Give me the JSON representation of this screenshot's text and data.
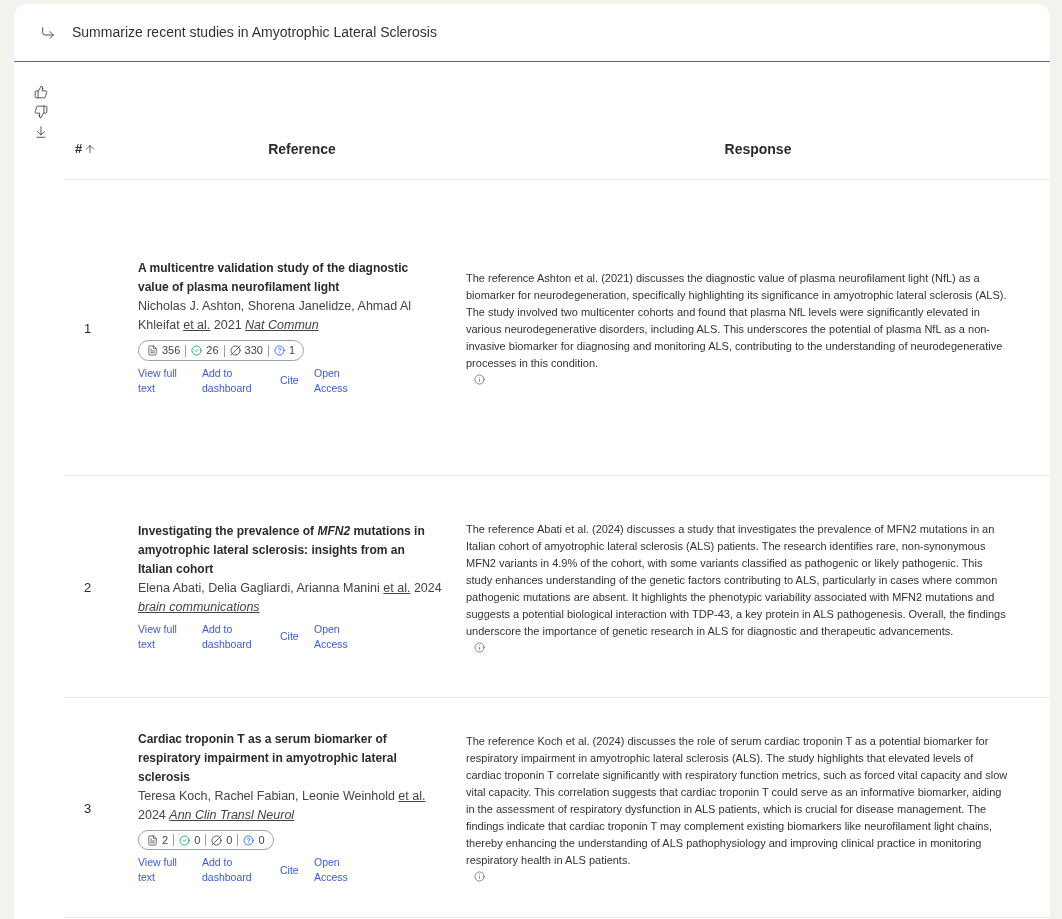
{
  "query": "Summarize recent studies in Amyotrophic Lateral Sclerosis",
  "columns": [
    "#",
    "Reference",
    "Response"
  ],
  "rows": [
    {
      "number": "1",
      "title": "A multicentre validation study of the diagnostic value of plasma neurofilament light",
      "citation": [
        {
          "kind": "text",
          "text": "Nicholas J. Ashton, Shorena Janelidze, Ahmad Al Khleifat"
        },
        {
          "kind": "link",
          "text": "et al."
        },
        {
          "kind": "text",
          "text": "2021"
        },
        {
          "kind": "journal",
          "text": "Nat Commun"
        }
      ],
      "metrics": [
        "356",
        "26",
        "330",
        "1"
      ],
      "actions": [
        "View full text",
        "Add to dashboard",
        "Cite",
        "Open Access"
      ],
      "response": "The reference Ashton et al. (2021) discusses the diagnostic value of plasma neurofilament light (NfL) as a biomarker for neurodegeneration, specifically highlighting its significance in amyotrophic lateral sclerosis (ALS). The study involved two multicenter cohorts and found that plasma NfL levels were significantly elevated in various neurodegenerative disorders, including ALS. This underscores the potential of plasma NfL as a non-invasive biomarker for diagnosing and monitoring ALS, contributing to the understanding of neurodegenerative processes in this condition."
    },
    {
      "number": "2",
      "title": "Investigating the prevalence of *MFN2* mutations in amyotrophic lateral sclerosis: insights from an Italian cohort",
      "citation": [
        {
          "kind": "text",
          "text": "Elena Abati, Delia Gagliardi, Arianna Manini"
        },
        {
          "kind": "link",
          "text": "et al."
        },
        {
          "kind": "text",
          "text": "2024"
        },
        {
          "kind": "journal",
          "text": "brain communications"
        }
      ],
      "actions": [
        "View full text",
        "Add to dashboard",
        "Cite",
        "Open Access"
      ],
      "response": "The reference Abati et al. (2024) discusses a study that investigates the prevalence of MFN2 mutations in an Italian cohort of amyotrophic lateral sclerosis (ALS) patients. The research identifies rare, non-synonymous MFN2 variants in 4.9% of the cohort, with some variants classified as pathogenic or likely pathogenic. This study enhances understanding of the genetic factors contributing to ALS, particularly in cases where common pathogenic mutations are absent. It highlights the phenotypic variability associated with MFN2 mutations and suggests a potential biological interaction with TDP-43, a key protein in ALS pathogenesis. Overall, the findings underscore the importance of genetic research in ALS for diagnostic and therapeutic advancements."
    },
    {
      "number": "3",
      "title": "Cardiac troponin T as a serum biomarker of respiratory impairment in amyotrophic lateral sclerosis",
      "citation": [
        {
          "kind": "text",
          "text": "Teresa Koch, Rachel Fabian, Leonie Weinhold"
        },
        {
          "kind": "link",
          "text": "et al."
        },
        {
          "kind": "text",
          "text": "2024"
        },
        {
          "kind": "journal",
          "text": "Ann Clin Transl Neurol"
        }
      ],
      "metrics": [
        "2",
        "0",
        "0",
        "0"
      ],
      "actions": [
        "View full text",
        "Add to dashboard",
        "Cite",
        "Open Access"
      ],
      "response": "The reference Koch et al. (2024) discusses the role of serum cardiac troponin T as a potential biomarker for respiratory impairment in amyotrophic lateral sclerosis (ALS). The study highlights that elevated levels of cardiac troponin T correlate significantly with respiratory function metrics, such as forced vital capacity and slow vital capacity. This correlation suggests that cardiac troponin T could serve as an informative biomarker, aiding in the assessment of respiratory dysfunction in ALS patients, which is crucial for disease management. The findings indicate that cardiac troponin T may complement existing biomarkers like neurofilament light chains, thereby enhancing the understanding of ALS pathophysiology and improving clinical practice in monitoring respiratory health in ALS patients."
    }
  ]
}
